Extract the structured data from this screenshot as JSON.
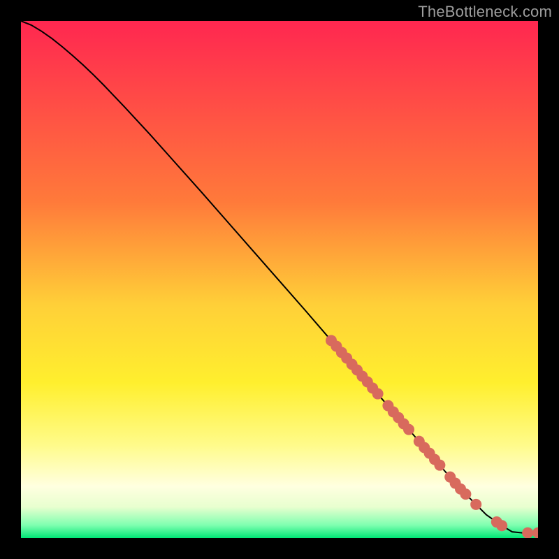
{
  "attribution": "TheBottleneck.com",
  "chart_data": {
    "type": "line",
    "title": "",
    "xlabel": "",
    "ylabel": "",
    "xlim": [
      0,
      100
    ],
    "ylim": [
      0,
      100
    ],
    "background_gradient": {
      "stops": [
        {
          "offset": 0,
          "color": "#ff2750"
        },
        {
          "offset": 0.35,
          "color": "#ff7a3a"
        },
        {
          "offset": 0.55,
          "color": "#ffd038"
        },
        {
          "offset": 0.7,
          "color": "#ffef2e"
        },
        {
          "offset": 0.82,
          "color": "#fffb8a"
        },
        {
          "offset": 0.9,
          "color": "#ffffe0"
        },
        {
          "offset": 0.94,
          "color": "#e8ffcf"
        },
        {
          "offset": 0.975,
          "color": "#7fffb0"
        },
        {
          "offset": 1.0,
          "color": "#00e676"
        }
      ]
    },
    "series": [
      {
        "name": "bottleneck-curve",
        "color": "#000000",
        "x": [
          0,
          2,
          4,
          6,
          8,
          10,
          12,
          14,
          16,
          18,
          20,
          25,
          30,
          35,
          40,
          45,
          50,
          55,
          60,
          65,
          70,
          75,
          80,
          85,
          90,
          93,
          95,
          97,
          98,
          100
        ],
        "y": [
          100,
          99.2,
          98.0,
          96.6,
          95.0,
          93.3,
          91.5,
          89.6,
          87.6,
          85.5,
          83.4,
          78.0,
          72.4,
          66.8,
          61.1,
          55.4,
          49.7,
          44.0,
          38.2,
          32.5,
          26.7,
          21.0,
          15.2,
          9.5,
          4.5,
          2.4,
          1.2,
          1.0,
          1.0,
          1.0
        ]
      }
    ],
    "points": {
      "name": "highlighted-points",
      "color": "#d86a5d",
      "radius": 8,
      "data": [
        {
          "x": 60,
          "y": 38.2
        },
        {
          "x": 61,
          "y": 37.1
        },
        {
          "x": 62,
          "y": 35.9
        },
        {
          "x": 63,
          "y": 34.8
        },
        {
          "x": 64,
          "y": 33.6
        },
        {
          "x": 65,
          "y": 32.5
        },
        {
          "x": 66,
          "y": 31.3
        },
        {
          "x": 67,
          "y": 30.2
        },
        {
          "x": 68,
          "y": 29.0
        },
        {
          "x": 69,
          "y": 27.9
        },
        {
          "x": 71,
          "y": 25.6
        },
        {
          "x": 72,
          "y": 24.4
        },
        {
          "x": 73,
          "y": 23.3
        },
        {
          "x": 74,
          "y": 22.1
        },
        {
          "x": 75,
          "y": 21.0
        },
        {
          "x": 77,
          "y": 18.7
        },
        {
          "x": 78,
          "y": 17.5
        },
        {
          "x": 79,
          "y": 16.4
        },
        {
          "x": 80,
          "y": 15.2
        },
        {
          "x": 81,
          "y": 14.1
        },
        {
          "x": 83,
          "y": 11.8
        },
        {
          "x": 84,
          "y": 10.6
        },
        {
          "x": 85,
          "y": 9.5
        },
        {
          "x": 86,
          "y": 8.5
        },
        {
          "x": 88,
          "y": 6.5
        },
        {
          "x": 92,
          "y": 3.1
        },
        {
          "x": 93,
          "y": 2.4
        },
        {
          "x": 98,
          "y": 1.0
        },
        {
          "x": 100,
          "y": 1.0
        }
      ]
    }
  }
}
